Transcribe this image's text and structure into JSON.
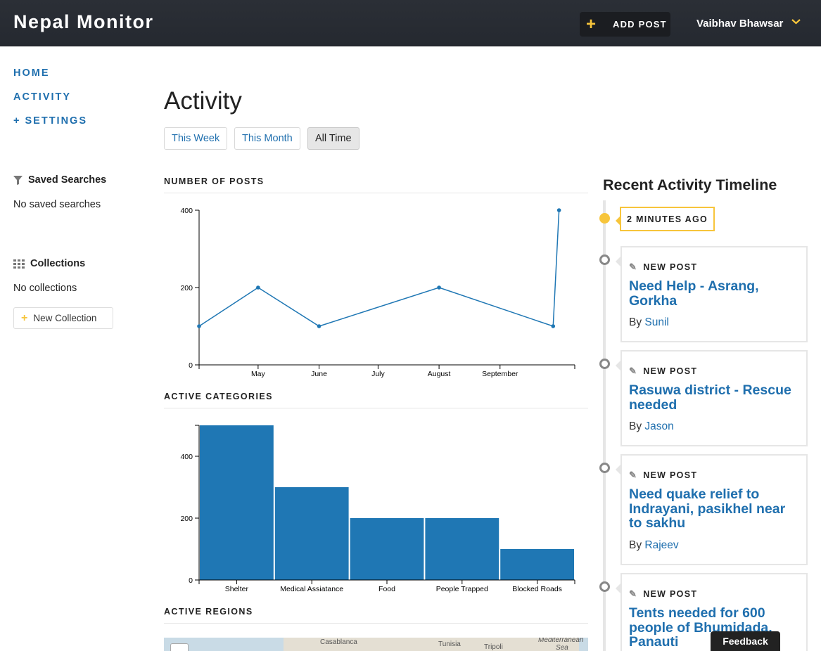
{
  "header": {
    "brand": "Nepal Monitor",
    "add_post_label": "ADD POST",
    "user_name": "Vaibhav Bhawsar",
    "accent_color": "#f7c53b",
    "icons": {
      "add": "plus-icon",
      "user_menu": "chevron-down-icon"
    }
  },
  "sidebar": {
    "nav": [
      {
        "label": "HOME"
      },
      {
        "label": "ACTIVITY"
      },
      {
        "label": "+ SETTINGS"
      }
    ],
    "saved_searches": {
      "heading": "Saved Searches",
      "empty": "No saved searches",
      "icon": "filter-icon"
    },
    "collections": {
      "heading": "Collections",
      "empty": "No collections",
      "new_label": "New Collection",
      "icon": "grid-icon"
    }
  },
  "main": {
    "title": "Activity",
    "filters": [
      {
        "label": "This Week",
        "active": false
      },
      {
        "label": "This Month",
        "active": false
      },
      {
        "label": "All Time",
        "active": true
      }
    ],
    "sections": {
      "posts": "NUMBER OF POSTS",
      "categories": "ACTIVE CATEGORIES",
      "regions": "ACTIVE REGIONS"
    },
    "map_labels": [
      "Casablanca",
      "Tunisia",
      "Tripoli",
      "Mediterranean",
      "Sea"
    ]
  },
  "chart_data": [
    {
      "type": "line",
      "title": "NUMBER OF POSTS",
      "x_ticks": [
        "May",
        "June",
        "July",
        "August",
        "September"
      ],
      "y_ticks": [
        "0",
        "200",
        "400"
      ],
      "ylim": [
        0,
        400
      ],
      "points": [
        {
          "x": "2015-04-01",
          "y": 100
        },
        {
          "x": "2015-05-01",
          "y": 200
        },
        {
          "x": "2015-06-01",
          "y": 100
        },
        {
          "x": "2015-08-01",
          "y": 200
        },
        {
          "x": "2015-09-28",
          "y": 100
        },
        {
          "x": "2015-10-01",
          "y": 400
        }
      ],
      "color": "#1f77b4",
      "grid": false
    },
    {
      "type": "bar",
      "title": "ACTIVE CATEGORIES",
      "categories": [
        "Shelter",
        "Medical Assiatance",
        "Food",
        "People Trapped",
        "Blocked Roads"
      ],
      "values": [
        500,
        300,
        200,
        200,
        100
      ],
      "y_ticks": [
        "0",
        "200",
        "400"
      ],
      "ylim": [
        0,
        500
      ],
      "color": "#1f77b4",
      "grid": false
    }
  ],
  "timeline": {
    "heading": "Recent Activity Timeline",
    "time_label": "2 MINUTES AGO",
    "items": [
      {
        "type": "NEW POST",
        "title": "Need Help - Asrang, Gorkha",
        "by": "By",
        "author": "Sunil"
      },
      {
        "type": "NEW POST",
        "title": "Rasuwa district - Rescue needed",
        "by": "By",
        "author": "Jason"
      },
      {
        "type": "NEW POST",
        "title": "Need quake relief to Indrayani, pasikhel near to sakhu",
        "by": "By",
        "author": "Rajeev"
      },
      {
        "type": "NEW POST",
        "title": "Tents needed for 600 people of Bhumidada, Panauti",
        "by": "",
        "author": ""
      }
    ]
  },
  "feedback_label": "Feedback"
}
